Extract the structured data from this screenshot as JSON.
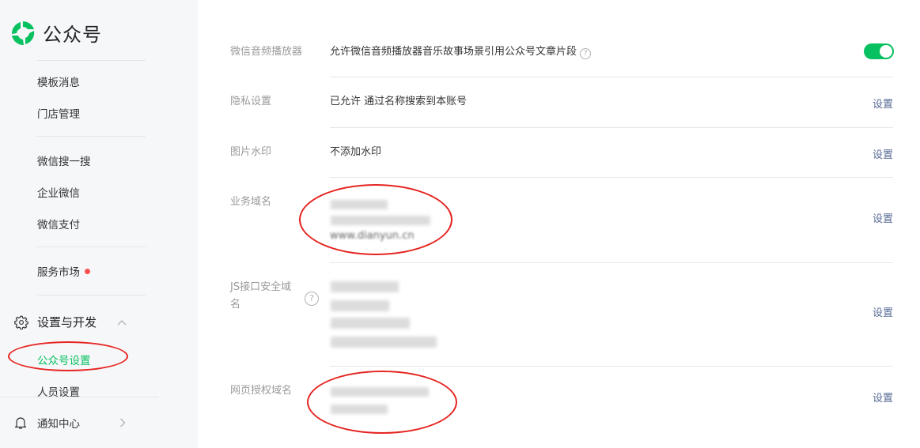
{
  "app": {
    "logo_text": "公众号"
  },
  "sidebar": {
    "items": [
      {
        "label": "模板消息"
      },
      {
        "label": "门店管理"
      },
      {
        "label": "微信搜一搜"
      },
      {
        "label": "企业微信"
      },
      {
        "label": "微信支付"
      },
      {
        "label": "服务市场"
      }
    ],
    "section": {
      "label": "设置与开发"
    },
    "sub_items": [
      {
        "label": "公众号设置"
      },
      {
        "label": "人员设置"
      }
    ],
    "notify": {
      "label": "通知中心"
    }
  },
  "settings": {
    "rows": [
      {
        "label": "微信音频播放器",
        "value": "允许微信音频播放器音乐故事场景引用公众号文章片段"
      },
      {
        "label": "隐私设置",
        "value": "已允许 通过名称搜索到本账号",
        "action": "设置"
      },
      {
        "label": "图片水印",
        "value": "不添加水印",
        "action": "设置"
      },
      {
        "label": "业务域名",
        "values": [
          "www.dianyun.cn"
        ],
        "action": "设置"
      },
      {
        "label_line1": "JS接口安全域",
        "label_line2": "名",
        "action": "设置"
      },
      {
        "label": "网页授权域名",
        "action": "设置"
      }
    ]
  },
  "colors": {
    "accent": "#07c160",
    "link": "#576b95",
    "annotation": "#e52420"
  }
}
